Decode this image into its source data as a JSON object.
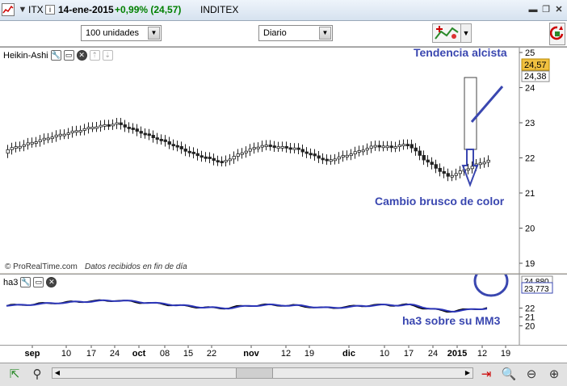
{
  "header": {
    "ticker": "ITX",
    "date": "14-ene-2015",
    "change": "+0,99% (24,57)",
    "name": "INDITEX"
  },
  "toolbar": {
    "units_value": "100 unidades",
    "period_value": "Diario"
  },
  "main_panel": {
    "indicator_label": "Heikin-Ashi",
    "copyright": "© ProRealTime.com",
    "data_note": "Datos recibidos en fin de día",
    "price_badge": "24,57",
    "second_price": "24,38",
    "y_ticks": [
      "25",
      "24",
      "23",
      "22",
      "21",
      "20",
      "19"
    ]
  },
  "annotations": {
    "trend": "Tendencia alcista",
    "color_change": "Cambio brusco de color",
    "ha3": "ha3 sobre su MM3"
  },
  "sub_panel": {
    "label": "ha3",
    "badge_top": "24,880",
    "badge_bottom": "23,773",
    "y_ticks": [
      "22",
      "21",
      "20"
    ]
  },
  "x_axis": {
    "labels": [
      "sep",
      "10",
      "17",
      "24",
      "oct",
      "08",
      "15",
      "22",
      "nov",
      "12",
      "19",
      "dic",
      "10",
      "17",
      "24",
      "2015",
      "12",
      "19"
    ]
  },
  "colors": {
    "accent_green": "#008000",
    "annotation_blue": "#3a47b0",
    "price_badge_bg": "#f0c040",
    "ma_blue": "#2c36b8"
  },
  "icons": [
    "settings-icon",
    "window-icon",
    "close-icon",
    "arrow-down-icon",
    "zoom-in-icon",
    "zoom-out-icon",
    "magnifier-icon"
  ]
}
